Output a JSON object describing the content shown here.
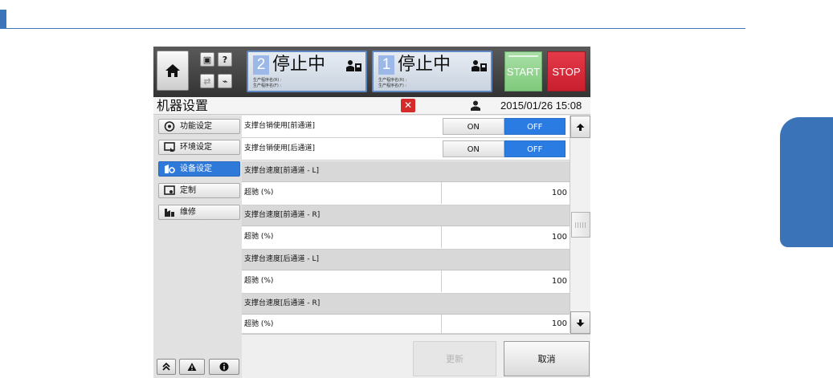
{
  "colors": {
    "document_accent": "#3c74b9",
    "active_nav": "#2f79d8",
    "toggle_off_selected": "#2b7ce2",
    "start_button": "#8fd18c",
    "stop_button": "#d62a3a",
    "close_button": "#d42a2a",
    "lane_number_bg": "#9cb8e8"
  },
  "header": {
    "home_icon": "home-icon",
    "mini_buttons": [
      "▣",
      "?",
      "⇄",
      "⌁"
    ],
    "lanes": [
      {
        "number": "2",
        "status": "停止中",
        "program_front": "生产程序名(R) :",
        "program_rear": "生产程序名(F) :",
        "icon": "operator-icon"
      },
      {
        "number": "1",
        "status": "停止中",
        "program_front": "生产程序名(R) :",
        "program_rear": "生产程序名(F) :",
        "icon": "operator-icon"
      }
    ],
    "start_label": "START",
    "stop_label": "STOP"
  },
  "titlebar": {
    "title": "机器设置",
    "close_label": "✕",
    "user_icon": "user-icon",
    "datetime": "2015/01/26 15:08"
  },
  "sidebar": {
    "items": [
      {
        "label": "功能设定",
        "icon": "function-icon",
        "active": false
      },
      {
        "label": "环境设定",
        "icon": "environment-icon",
        "active": false
      },
      {
        "label": "设备设定",
        "icon": "device-icon",
        "active": true
      },
      {
        "label": "定制",
        "icon": "custom-icon",
        "active": false
      },
      {
        "label": "维修",
        "icon": "maintenance-icon",
        "active": false
      }
    ],
    "bottom_icons": [
      "double-chevron-up-icon",
      "warning-icon",
      "info-icon"
    ]
  },
  "settings": {
    "toggle_rows": [
      {
        "label": "支撑台销使用[前通道]",
        "on_label": "ON",
        "off_label": "OFF",
        "selected": "OFF"
      },
      {
        "label": "支撑台销使用[后通道]",
        "on_label": "ON",
        "off_label": "OFF",
        "selected": "OFF"
      }
    ],
    "groups": [
      {
        "header": "支撑台速度[前通道 - L]",
        "field_label": "超驰 (%)",
        "value": "100"
      },
      {
        "header": "支撑台速度[前通道 - R]",
        "field_label": "超驰 (%)",
        "value": "100"
      },
      {
        "header": "支撑台速度[后通道 - L]",
        "field_label": "超驰 (%)",
        "value": "100"
      },
      {
        "header": "支撑台速度[后通道 - R]",
        "field_label": "超驰 (%)",
        "value": "100"
      }
    ]
  },
  "footer": {
    "update_label": "更新",
    "cancel_label": "取消"
  }
}
